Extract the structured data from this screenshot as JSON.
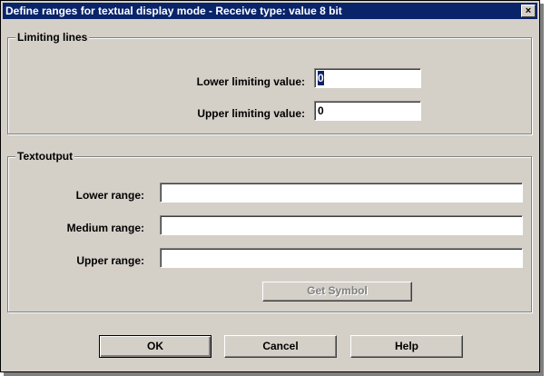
{
  "window": {
    "title": "Define ranges for textual display mode - Receive type: value 8 bit",
    "close_glyph": "×"
  },
  "limiting_lines": {
    "group_label": "Limiting lines",
    "lower_label": "Lower limiting value:",
    "lower_value": "0",
    "upper_label": "Upper limiting value:",
    "upper_value": "0"
  },
  "textoutput": {
    "group_label": "Textoutput",
    "lower_label": "Lower range:",
    "lower_value": "",
    "medium_label": "Medium range:",
    "medium_value": "",
    "upper_label": "Upper range:",
    "upper_value": "",
    "get_symbol_label": "Get Symbol"
  },
  "buttons": {
    "ok": "OK",
    "cancel": "Cancel",
    "help": "Help"
  },
  "colors": {
    "title_bar": "#0a246a",
    "dialog_face": "#d4d0c8",
    "field_background": "#ffffff",
    "disabled_text": "#808080"
  }
}
